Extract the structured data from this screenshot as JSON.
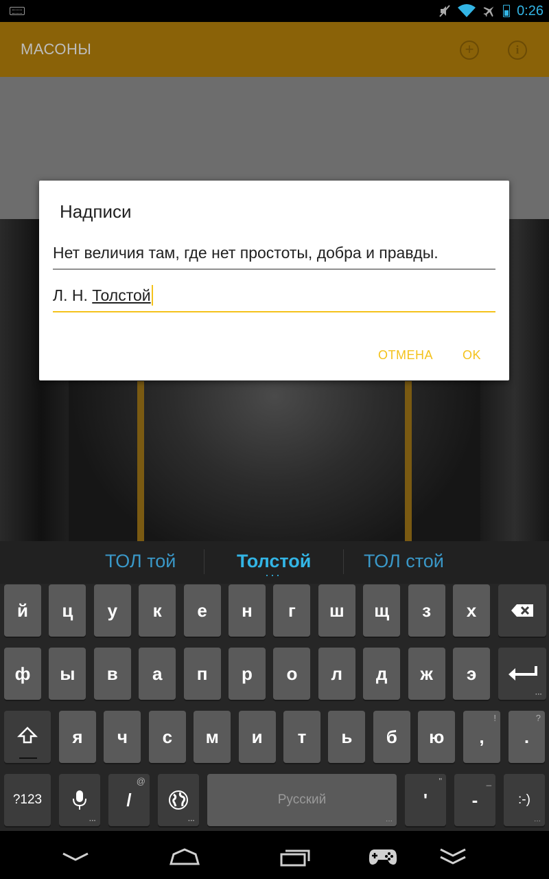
{
  "status_bar": {
    "time": "0:26"
  },
  "app_bar": {
    "title": "МАСОНЫ"
  },
  "dialog": {
    "title": "Надписи",
    "quote_value": "Нет величия там, где нет простоты, добра и правды.",
    "author_prefix": "Л. Н. ",
    "author_word": "Толстой",
    "cancel_label": "ОТМЕНА",
    "ok_label": "OK"
  },
  "keyboard": {
    "suggestions": [
      "ТОЛ той",
      "Толстой",
      "ТОЛ стой"
    ],
    "row1": [
      "й",
      "ц",
      "у",
      "к",
      "е",
      "н",
      "г",
      "ш",
      "щ",
      "з",
      "х"
    ],
    "row2": [
      "ф",
      "ы",
      "в",
      "а",
      "п",
      "р",
      "о",
      "л",
      "д",
      "ж",
      "э"
    ],
    "row3": [
      "я",
      "ч",
      "с",
      "м",
      "и",
      "т",
      "ь",
      "б",
      "ю"
    ],
    "comma_label": ",",
    "comma_hint": "!",
    "period_label": ".",
    "period_hint": "?",
    "symbols_label": "?123",
    "slash_label": "/",
    "slash_hint": "@",
    "space_label": "Русский",
    "apostrophe_label": "'",
    "apostrophe_hint": "\"",
    "dash_label": "-",
    "dash_hint": "_",
    "smiley_label": ":-)"
  },
  "colors": {
    "accent": "#f4c21b",
    "app_bar": "#8a6208",
    "suggestion": "#33b5e5"
  }
}
